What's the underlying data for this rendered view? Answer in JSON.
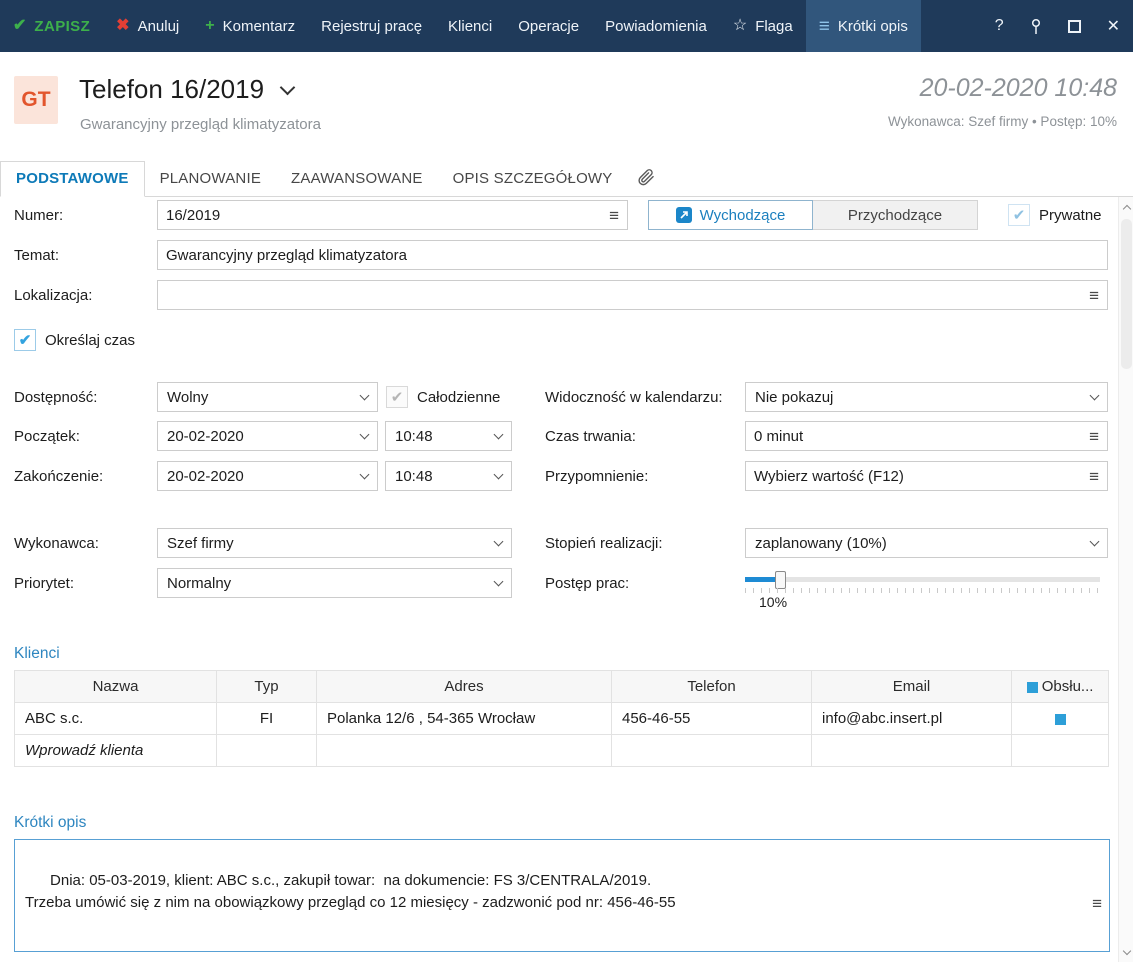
{
  "colors": {
    "toolbar_bg": "#1f3a5a",
    "accent_blue": "#1b7fbe",
    "success_green": "#3db04b",
    "danger_red": "#e23f35",
    "section_heading": "#2e86c0",
    "checkbox_blue": "#33a3df",
    "slider_fill": "#1e8bd4"
  },
  "icons": {
    "save": "✔",
    "cancel": "✖",
    "comment": "+",
    "flag": "☆",
    "list": "≡",
    "menu": "≡",
    "help": "?",
    "close": "✕",
    "check": "✔",
    "arrow": "↗"
  },
  "toolbar": {
    "save": "ZAPISZ",
    "cancel": "Anuluj",
    "comment": "Komentarz",
    "register_work": "Rejestruj pracę",
    "clients": "Klienci",
    "operations": "Operacje",
    "notifications": "Powiadomienia",
    "flag": "Flaga",
    "short_description": "Krótki opis"
  },
  "header": {
    "badge": "GT",
    "title": "Telefon 16/2019",
    "subtitle": "Gwarancyjny przegląd klimatyzatora",
    "datetime": "20-02-2020 10:48",
    "meta": "Wykonawca: Szef firmy  •  Postęp: 10%"
  },
  "tabs": {
    "basic": "PODSTAWOWE",
    "planning": "PLANOWANIE",
    "advanced": "ZAAWANSOWANE",
    "detailed": "OPIS SZCZEGÓŁOWY"
  },
  "form": {
    "number_label": "Numer:",
    "number_value": "16/2019",
    "outgoing": "Wychodzące",
    "incoming": "Przychodzące",
    "private": "Prywatne",
    "subject_label": "Temat:",
    "subject_value": "Gwarancyjny przegląd klimatyzatora",
    "location_label": "Lokalizacja:",
    "location_value": "",
    "define_time": "Określaj czas",
    "availability_label": "Dostępność:",
    "availability_value": "Wolny",
    "all_day": "Całodzienne",
    "calendar_visibility_label": "Widoczność w kalendarzu:",
    "calendar_visibility_value": "Nie pokazuj",
    "start_label": "Początek:",
    "start_date": "20-02-2020",
    "start_time": "10:48",
    "duration_label": "Czas trwania:",
    "duration_value": "0 minut",
    "end_label": "Zakończenie:",
    "end_date": "20-02-2020",
    "end_time": "10:48",
    "reminder_label": "Przypomnienie:",
    "reminder_value": "Wybierz wartość (F12)",
    "executor_label": "Wykonawca:",
    "executor_value": "Szef firmy",
    "completion_label": "Stopień realizacji:",
    "completion_value": "zaplanowany  (10%)",
    "priority_label": "Priorytet:",
    "priority_value": "Normalny",
    "progress_label": "Postęp prac:",
    "progress_percent": "10%",
    "progress_value": 10
  },
  "clients": {
    "section_title": "Klienci",
    "columns": [
      "Nazwa",
      "Typ",
      "Adres",
      "Telefon",
      "Email",
      "Obsłu..."
    ],
    "rows": [
      {
        "name": "ABC s.c.",
        "type": "FI",
        "address": "Polanka  12/6 , 54-365 Wrocław",
        "phone": "456-46-55",
        "email": "info@abc.insert.pl",
        "serviced": true
      }
    ],
    "placeholder": "Wprowadź klienta"
  },
  "description": {
    "section_title": "Krótki opis",
    "text": "Dnia: 05-03-2019, klient: ABC s.c., zakupił towar:  na dokumencie: FS 3/CENTRALA/2019.\nTrzeba umówić się z nim na obowiązkowy przegląd co 12 miesięcy - zadzwonić pod nr: 456-46-55"
  }
}
